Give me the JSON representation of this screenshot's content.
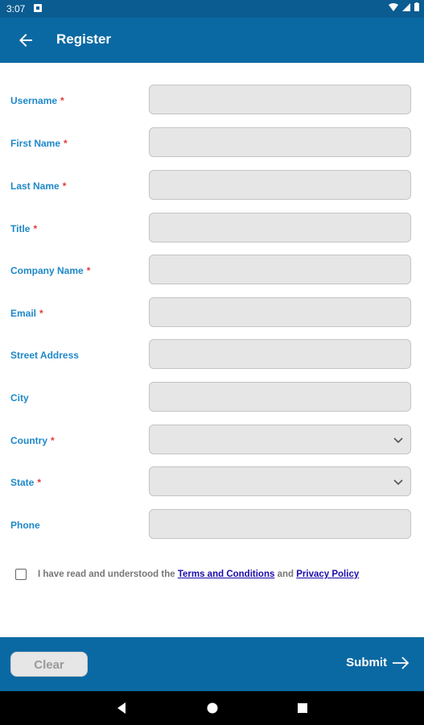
{
  "status_bar": {
    "time": "3:07"
  },
  "app_bar": {
    "title": "Register",
    "back_icon": "arrow-left-icon"
  },
  "form": {
    "fields": [
      {
        "label": "Username",
        "required": "*",
        "value": "",
        "type": "text"
      },
      {
        "label": "First Name",
        "required": "*",
        "value": "",
        "type": "text"
      },
      {
        "label": "Last Name",
        "required": "*",
        "value": "",
        "type": "text"
      },
      {
        "label": "Title",
        "required": "*",
        "value": "",
        "type": "text"
      },
      {
        "label": "Company Name",
        "required": "*",
        "value": "",
        "type": "text"
      },
      {
        "label": "Email",
        "required": "*",
        "value": "",
        "type": "text"
      },
      {
        "label": "Street Address",
        "required": "",
        "value": "",
        "type": "text"
      },
      {
        "label": "City",
        "required": "",
        "value": "",
        "type": "text"
      },
      {
        "label": "Country",
        "required": "*",
        "value": "",
        "type": "select"
      },
      {
        "label": "State",
        "required": "*",
        "value": "",
        "type": "select"
      },
      {
        "label": "Phone",
        "required": "",
        "value": "",
        "type": "text"
      }
    ]
  },
  "terms": {
    "prefix": "I have read and understood the",
    "terms_link": "Terms and Conditions",
    "and": "and",
    "privacy_link": "Privacy Policy",
    "checked": false
  },
  "bottom_bar": {
    "clear_label": "Clear",
    "submit_label": "Submit",
    "submit_icon": "arrow-right-icon"
  },
  "colors": {
    "app_bar": "#0a69a3",
    "status_bar": "#0a5c91",
    "label": "#1e88c8",
    "required": "#e53935",
    "link": "#1a0dab"
  }
}
